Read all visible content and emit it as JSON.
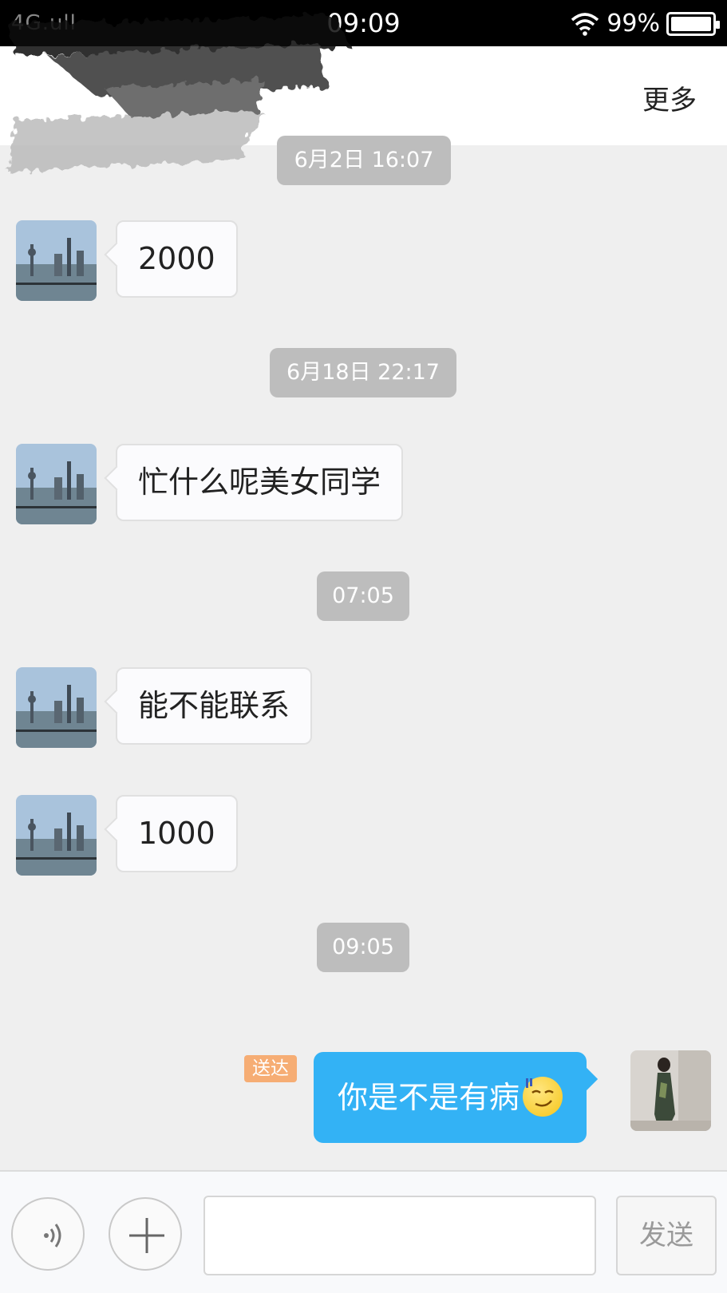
{
  "status_bar": {
    "carrier": "4G.ull",
    "time": "09:09",
    "battery_percent": "99%",
    "battery_level": 0.99
  },
  "header": {
    "more_label": "更多"
  },
  "chat": {
    "timestamps": [
      "6月2日 16:07",
      "6月18日 22:17",
      "07:05",
      "09:05"
    ],
    "incoming": [
      "2000",
      "忙什么呢美女同学",
      "能不能联系",
      "1000"
    ],
    "outgoing": {
      "text": "你是不是有病",
      "status": "送达",
      "emoji": "smirk-emoji"
    }
  },
  "input_bar": {
    "send_label": "发送",
    "input_value": "",
    "icons": [
      "voice-icon",
      "plus-icon"
    ]
  },
  "colors": {
    "outgoing_bubble": "#33b2f5",
    "delivered_badge": "#f6ad74",
    "timestamp_bg": "#bdbdbd",
    "background": "#efefef"
  }
}
